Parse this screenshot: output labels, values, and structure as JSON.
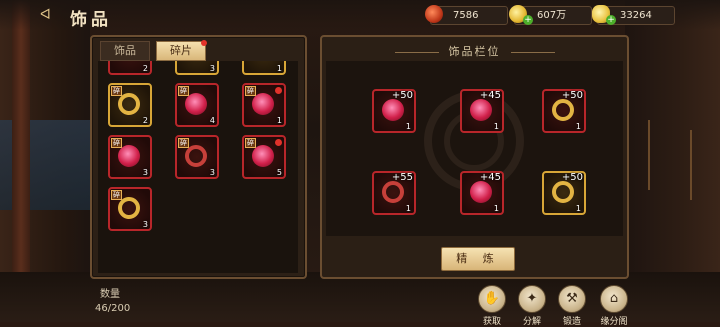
{
  "header": {
    "title": "饰品",
    "back_icon": "back-arrow-icon"
  },
  "resources": [
    {
      "name": "ruby",
      "icon": "ruby-icon",
      "value": "7586"
    },
    {
      "name": "gold",
      "icon": "gold-coin-icon",
      "value": "607万"
    },
    {
      "name": "ingot",
      "icon": "gold-ingot-icon",
      "value": "33264"
    }
  ],
  "left_panel": {
    "tabs": [
      {
        "label": "饰品",
        "active": false
      },
      {
        "label": "碎片",
        "active": true
      }
    ],
    "top_counts": [
      "2",
      "3",
      "1"
    ],
    "items": [
      {
        "badge": "碎",
        "count": "2",
        "frame": "gold",
        "item": "goldring"
      },
      {
        "badge": "碎",
        "count": "4",
        "frame": "red",
        "item": "gem"
      },
      {
        "badge": "碎",
        "count": "1",
        "frame": "red",
        "item": "gem"
      },
      {
        "badge": "碎",
        "count": "3",
        "frame": "red",
        "item": "gem"
      },
      {
        "badge": "碎",
        "count": "3",
        "frame": "red",
        "item": "ring"
      },
      {
        "badge": "碎",
        "count": "5",
        "frame": "red",
        "item": "gem"
      },
      {
        "badge": "碎",
        "count": "3",
        "frame": "red",
        "item": "goldring"
      }
    ],
    "quantity_label": "数量",
    "quantity_value": "46/200"
  },
  "right_panel": {
    "title": "饰品栏位",
    "slots": [
      {
        "bonus": "+50",
        "level": "1",
        "frame": "red",
        "item": "gem"
      },
      {
        "bonus": "+45",
        "level": "1",
        "frame": "red",
        "item": "gem"
      },
      {
        "bonus": "+50",
        "level": "1",
        "frame": "red",
        "item": "goldring"
      },
      {
        "bonus": "+55",
        "level": "1",
        "frame": "red",
        "item": "ring"
      },
      {
        "bonus": "+45",
        "level": "1",
        "frame": "red",
        "item": "gem"
      },
      {
        "bonus": "+50",
        "level": "1",
        "frame": "gold",
        "item": "goldring"
      }
    ],
    "refine_label": "精 炼"
  },
  "actions": [
    {
      "label": "获取",
      "icon": "obtain-icon",
      "glyph": "✋"
    },
    {
      "label": "分解",
      "icon": "decompose-icon",
      "glyph": "✦"
    },
    {
      "label": "锻造",
      "icon": "hammer-icon",
      "glyph": "⚒"
    },
    {
      "label": "缘分阁",
      "icon": "pavilion-icon",
      "glyph": "⌂"
    }
  ]
}
